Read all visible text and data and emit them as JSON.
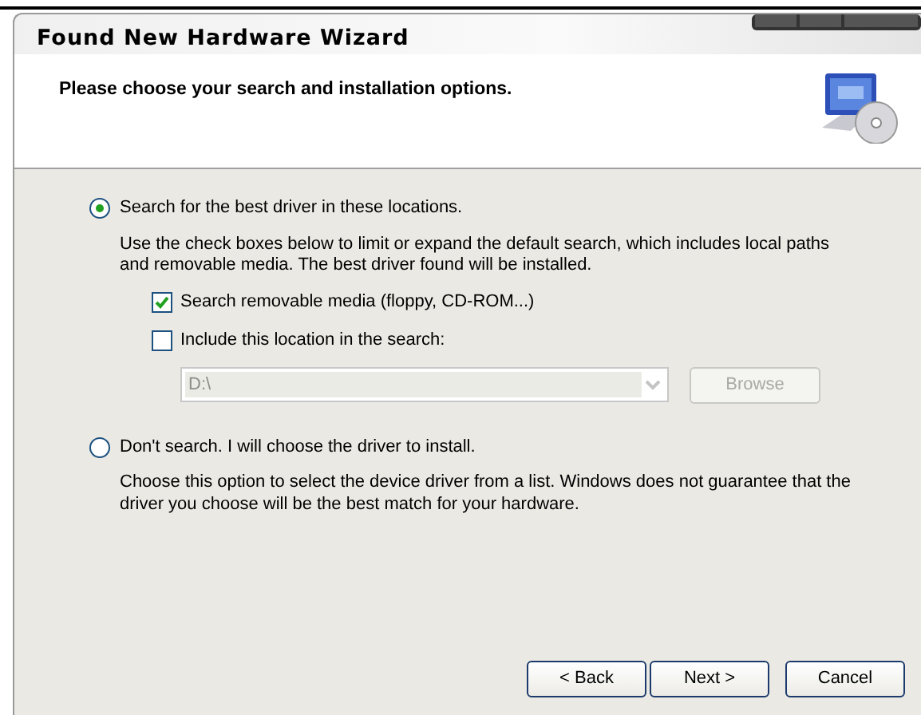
{
  "window": {
    "title": "Found New Hardware Wizard"
  },
  "header": {
    "heading": "Please choose your search and installation options."
  },
  "options": [
    {
      "label": "Search for the best driver in these locations.",
      "selected": true,
      "description": "Use the check boxes below to limit or expand the default search, which includes local paths and removable media. The best driver found will be installed.",
      "checkboxes": [
        {
          "label": "Search removable media (floppy, CD-ROM...)",
          "checked": true
        },
        {
          "label": "Include this location in the search:",
          "checked": false
        }
      ],
      "location": {
        "value": "D:\\",
        "disabled": true
      },
      "browse": {
        "label": "Browse",
        "disabled": true
      }
    },
    {
      "label": "Don't search. I will choose the driver to install.",
      "selected": false,
      "description": "Choose this option to select the device driver from a list.  Windows does not guarantee that the driver you choose will be the best match for your hardware."
    }
  ],
  "buttons": [
    {
      "label": "< Back"
    },
    {
      "label": "Next >"
    },
    {
      "label": "Cancel"
    }
  ]
}
